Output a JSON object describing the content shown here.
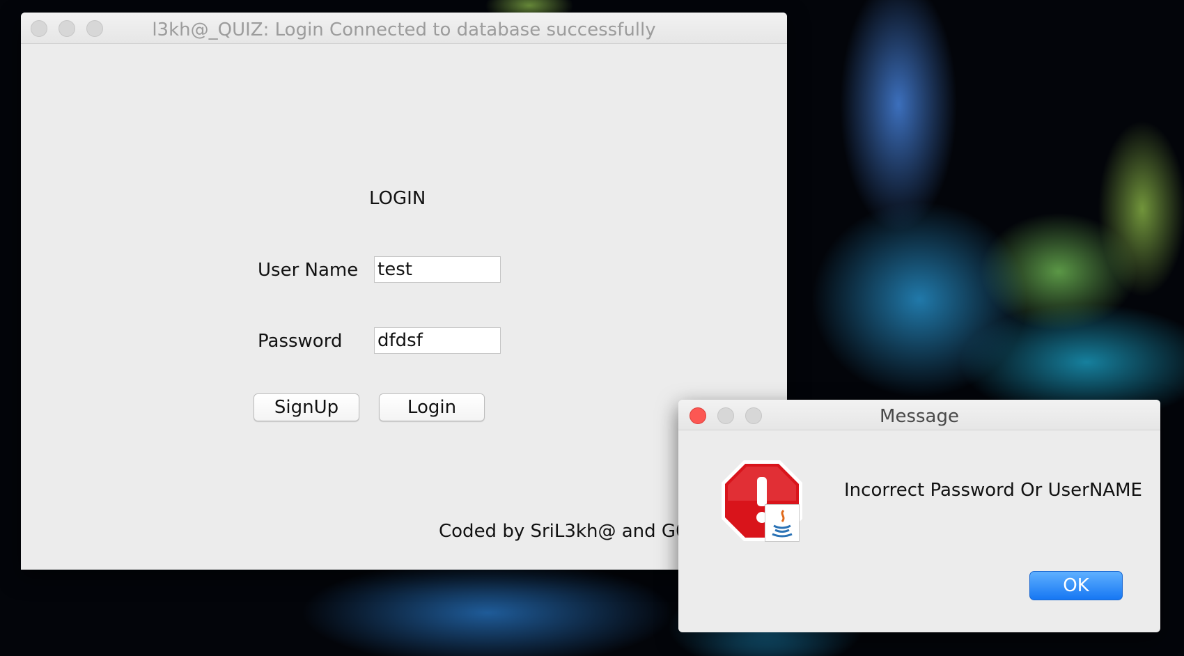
{
  "main_window": {
    "title": "l3kh@_QUIZ: Login Connected to database successfully",
    "heading": "LOGIN",
    "username_label": "User Name",
    "username_value": "test",
    "password_label": "Password",
    "password_value": "dfdsf",
    "signup_label": "SignUp",
    "login_label": "Login",
    "footer": "Coded by SriL3kh@ and G0v"
  },
  "dialog": {
    "title": "Message",
    "icon": "error-stop-icon",
    "message": "Incorrect Password Or UserNAME",
    "ok_label": "OK"
  },
  "colors": {
    "accent_button": "#1677f3",
    "error_icon": "#d9141b",
    "close_red": "#fc5753"
  }
}
